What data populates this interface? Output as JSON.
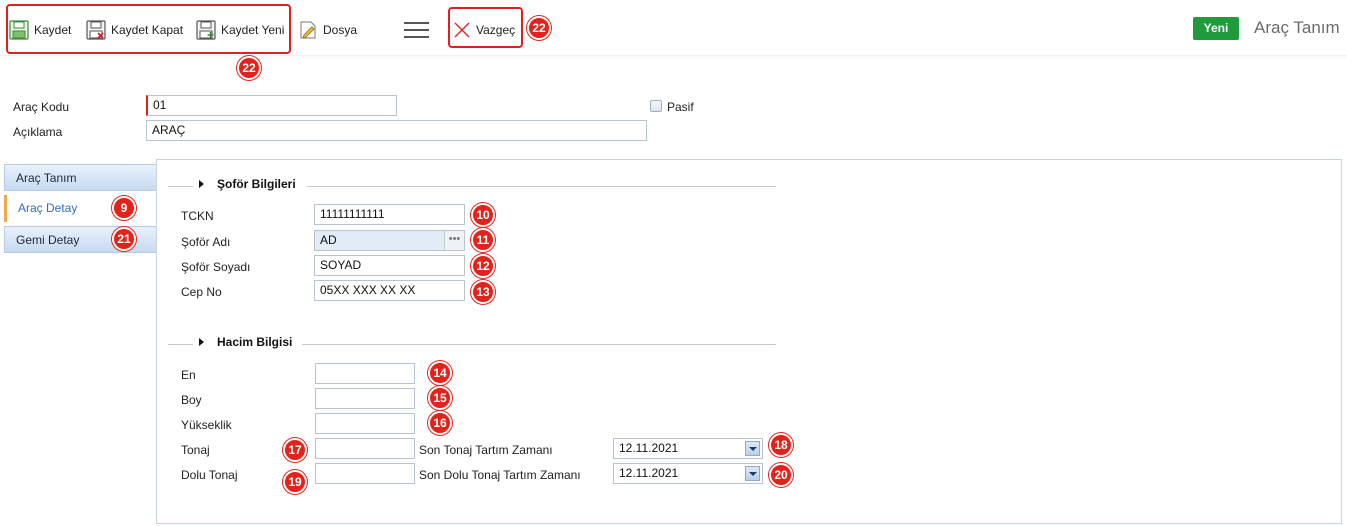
{
  "toolbar": {
    "save_label": "Kaydet",
    "save_close_label": "Kaydet Kapat",
    "save_new_label": "Kaydet Yeni",
    "file_label": "Dosya",
    "cancel_label": "Vazgeç",
    "new_label": "Yeni",
    "page_title": "Araç Tanım",
    "badge_save_group": "22",
    "badge_cancel": "22"
  },
  "header_form": {
    "code_label": "Araç Kodu",
    "code_value": "01",
    "desc_label": "Açıklama",
    "desc_value": "ARAÇ",
    "passive_label": "Pasif"
  },
  "side_tabs": [
    {
      "label": "Araç Tanım",
      "badge": ""
    },
    {
      "label": "Araç Detay",
      "badge": "9"
    },
    {
      "label": "Gemi Detay",
      "badge": "21"
    }
  ],
  "driver_section": {
    "title": "Şoför Bilgileri",
    "fields": [
      {
        "label": "TCKN",
        "value": "11111111111",
        "badge": "10"
      },
      {
        "label": "Şoför Adı",
        "value": "AD",
        "badge": "11"
      },
      {
        "label": "Şoför Soyadı",
        "value": "SOYAD",
        "badge": "12"
      },
      {
        "label": "Cep No",
        "value": "05XX XXX XX XX",
        "badge": "13"
      }
    ]
  },
  "volume_section": {
    "title": "Hacim Bilgisi",
    "fields": [
      {
        "label": "En",
        "value": "",
        "badge": "14"
      },
      {
        "label": "Boy",
        "value": "",
        "badge": "15"
      },
      {
        "label": "Yükseklik",
        "value": "",
        "badge": "16"
      },
      {
        "label": "Tonaj",
        "value": "",
        "badge": "17"
      },
      {
        "label": "Dolu Tonaj",
        "value": "",
        "badge": "19"
      }
    ],
    "dates": [
      {
        "label": "Son Tonaj Tartım Zamanı",
        "value": "12.11.2021",
        "badge": "18"
      },
      {
        "label": "Son Dolu Tonaj Tartım Zamanı",
        "value": "12.11.2021",
        "badge": "20"
      }
    ]
  },
  "colors": {
    "accent_red": "#e3231b",
    "new_button_green": "#1f9a3c",
    "active_tab_accent": "#f0a94a"
  }
}
